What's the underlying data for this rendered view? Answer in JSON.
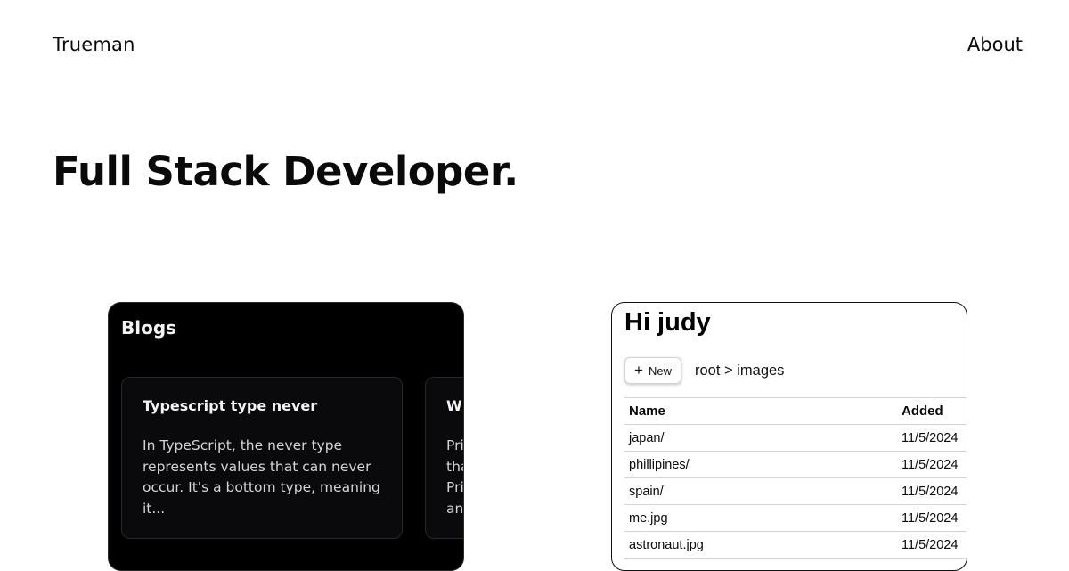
{
  "header": {
    "brand": "Trueman",
    "nav_about": "About"
  },
  "hero": {
    "title": "Full Stack Developer."
  },
  "blogs": {
    "title": "Blogs",
    "posts": [
      {
        "title": "Typescript type never",
        "excerpt": "In TypeScript, the never type represents values that can never occur. It's a bottom type, meaning it..."
      },
      {
        "title": "W",
        "excerpt": "Pri tha Pri an"
      }
    ]
  },
  "drive": {
    "greeting": "Hi judy",
    "new_button": "New",
    "breadcrumb": "root > images",
    "columns": [
      "Name",
      "Added"
    ],
    "rows": [
      {
        "name": "japan/",
        "added": "11/5/2024"
      },
      {
        "name": "phillipines/",
        "added": "11/5/2024"
      },
      {
        "name": "spain/",
        "added": "11/5/2024"
      },
      {
        "name": "me.jpg",
        "added": "11/5/2024"
      },
      {
        "name": "astronaut.jpg",
        "added": "11/5/2024"
      }
    ]
  }
}
